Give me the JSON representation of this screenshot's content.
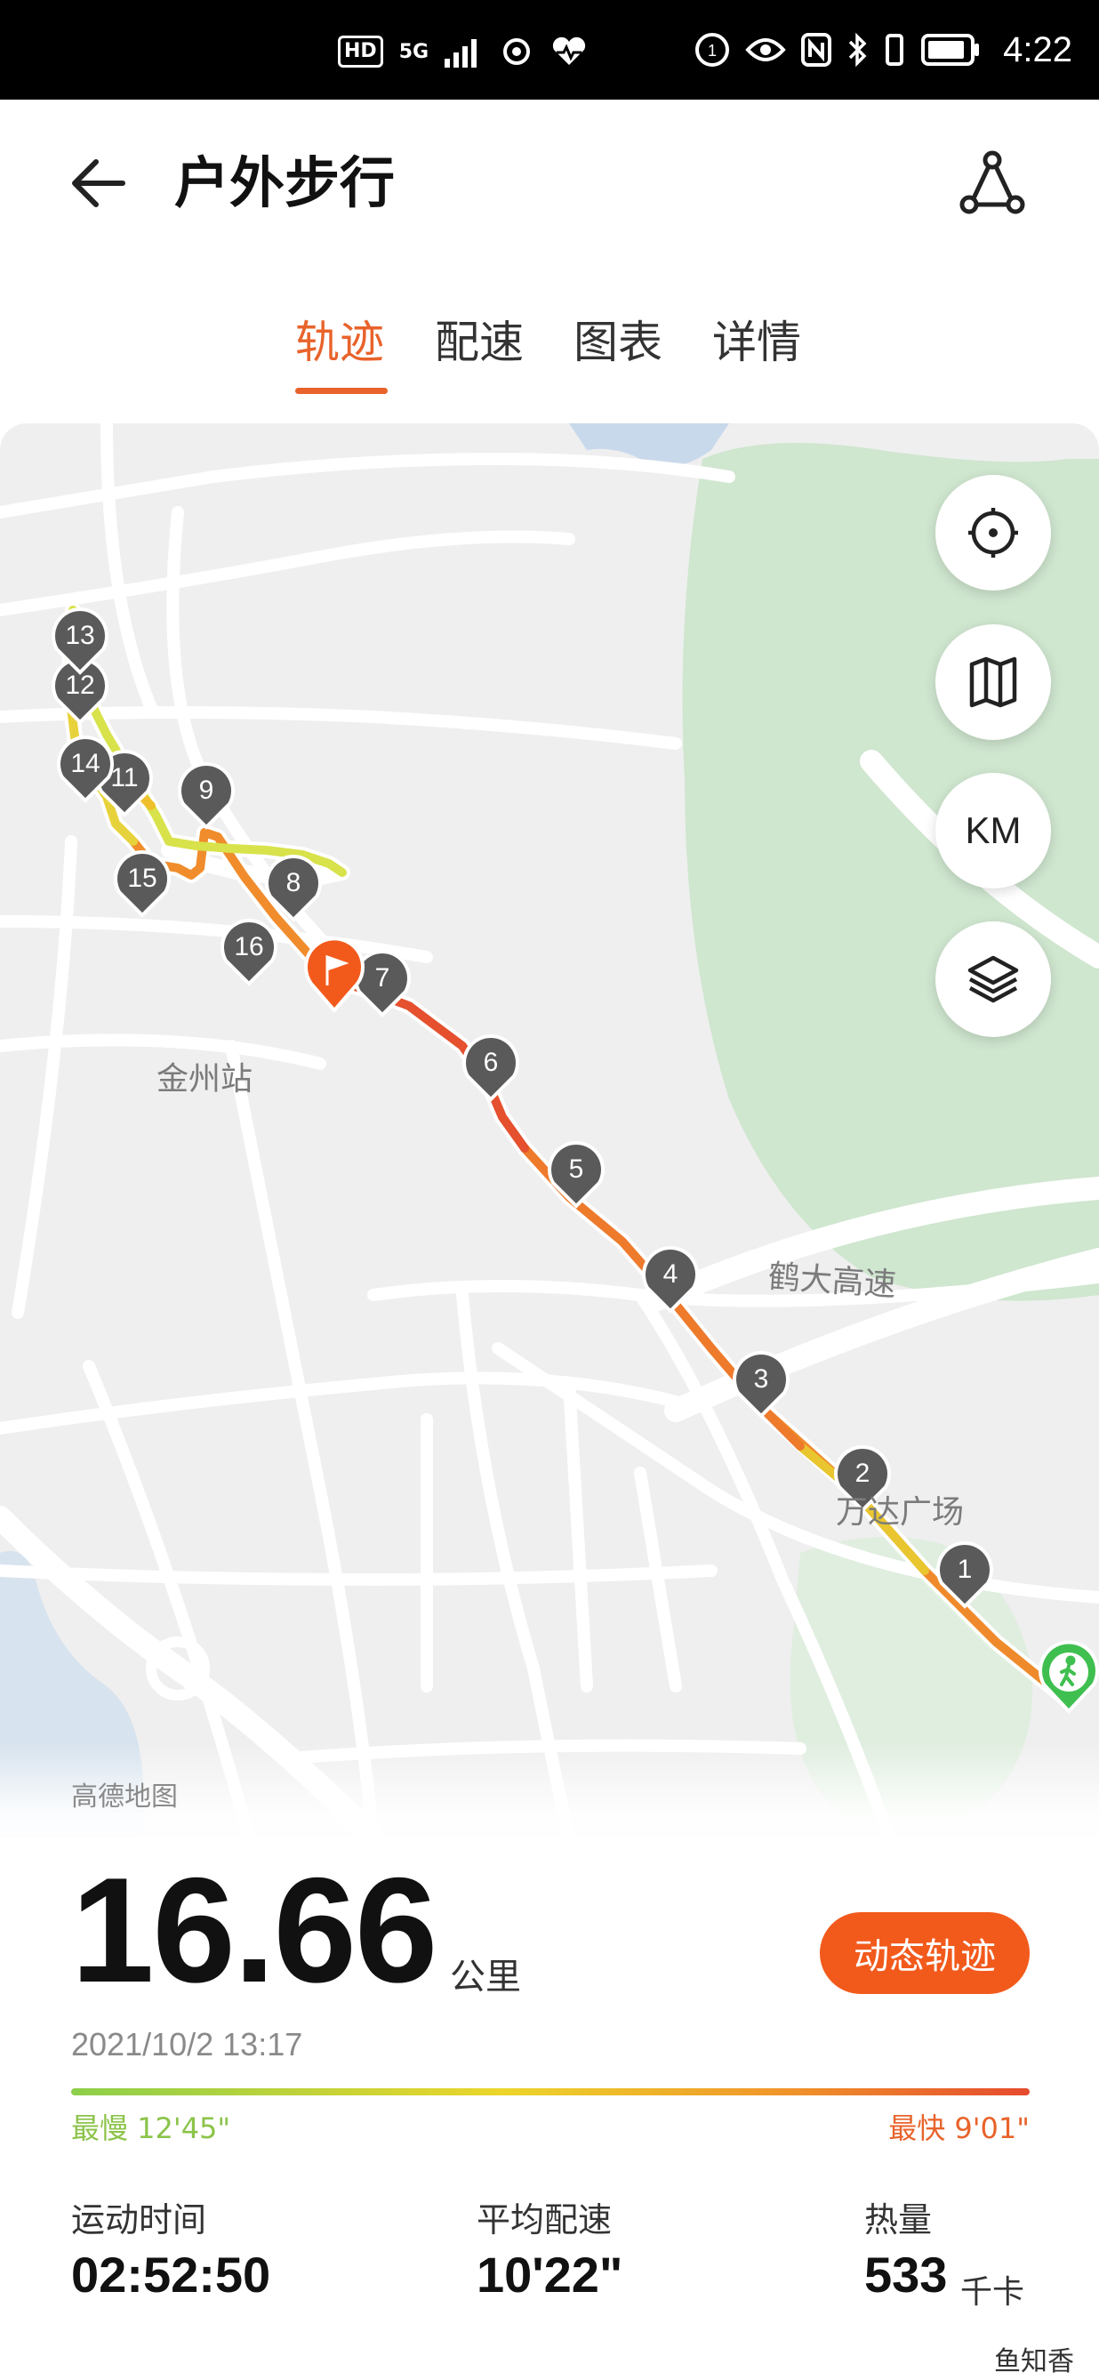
{
  "status_bar": {
    "badges": [
      "HD",
      "5G"
    ],
    "time": "4:22"
  },
  "header": {
    "title": "户外步行",
    "back_icon": "arrow-left-icon",
    "route_icon": "share-route-icon"
  },
  "tabs": [
    {
      "label": "轨迹",
      "active": true
    },
    {
      "label": "配速",
      "active": false
    },
    {
      "label": "图表",
      "active": false
    },
    {
      "label": "详情",
      "active": false
    }
  ],
  "map": {
    "buttons": [
      {
        "icon": "locate-icon"
      },
      {
        "icon": "map-icon"
      },
      {
        "label": "KM"
      },
      {
        "icon": "layers-icon"
      }
    ],
    "place_labels": [
      "金州站",
      "鹤大高速",
      "万达广场"
    ],
    "km_markers": [
      "1",
      "2",
      "3",
      "4",
      "5",
      "6",
      "7",
      "8",
      "9",
      "11",
      "12",
      "13",
      "14",
      "15",
      "16"
    ],
    "colors": {
      "track_fast": "#e54a2e",
      "track_slow": "#d7e34a",
      "start_marker": "#3fbf4f",
      "finish_marker": "#f25a1c",
      "km_marker": "#5a5a5a"
    }
  },
  "summary": {
    "map_provider": "高德地图",
    "distance": "16.66",
    "distance_unit": "公里",
    "dynamic_track_button": "动态轨迹",
    "datetime": "2021/10/2 13:17",
    "slowest": "最慢 12'45\"",
    "fastest": "最快 9'01\"",
    "stats": [
      {
        "label": "运动时间",
        "value": "02:52:50",
        "unit": ""
      },
      {
        "label": "平均配速",
        "value": "10'22\"",
        "unit": ""
      },
      {
        "label": "热量",
        "value": "533",
        "unit": "千卡"
      }
    ]
  },
  "watermark": "鱼知香"
}
